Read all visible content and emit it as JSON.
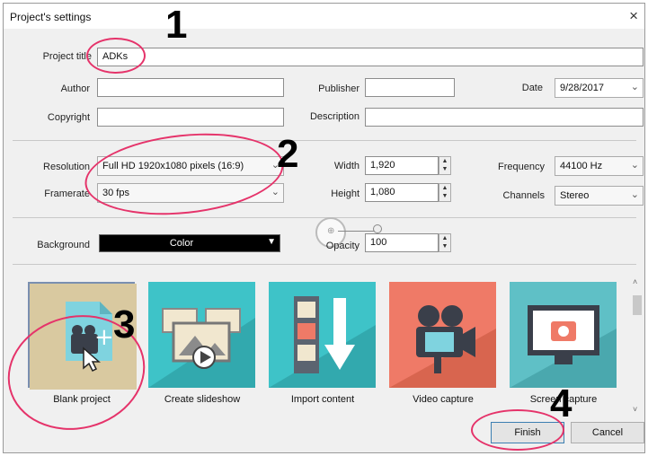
{
  "dialog": {
    "title": "Project's settings",
    "close_glyph": "×"
  },
  "fields": {
    "project_title_label": "Project title",
    "project_title_value": "ADKs",
    "author_label": "Author",
    "author_value": "",
    "publisher_label": "Publisher",
    "publisher_value": "",
    "date_label": "Date",
    "date_value": "9/28/2017",
    "copyright_label": "Copyright",
    "copyright_value": "",
    "description_label": "Description",
    "description_value": ""
  },
  "video": {
    "resolution_label": "Resolution",
    "resolution_value": "Full HD 1920x1080 pixels (16:9)",
    "framerate_label": "Framerate",
    "framerate_value": "30 fps",
    "width_label": "Width",
    "width_value": "1,920",
    "height_label": "Height",
    "height_value": "1,080",
    "frequency_label": "Frequency",
    "frequency_value": "44100 Hz",
    "channels_label": "Channels",
    "channels_value": "Stereo"
  },
  "background": {
    "label": "Background",
    "color_button": "Color",
    "opacity_label": "Opacity",
    "opacity_value": "100"
  },
  "templates": [
    {
      "label": "Blank project",
      "icon": "blank-project-icon",
      "bg": "#d9c9a0"
    },
    {
      "label": "Create slideshow",
      "icon": "slideshow-icon",
      "bg": "#3ec3c8"
    },
    {
      "label": "Import content",
      "icon": "import-content-icon",
      "bg": "#3ec3c8"
    },
    {
      "label": "Video capture",
      "icon": "video-camera-icon",
      "bg": "#ef7a67"
    },
    {
      "label": "Screen capture",
      "icon": "screen-capture-icon",
      "bg": "#5fc0c6"
    }
  ],
  "buttons": {
    "finish": "Finish",
    "cancel": "Cancel"
  },
  "annotations": {
    "n1": "1",
    "n2": "2",
    "n3": "3",
    "n4": "4",
    "color": "#e5336a"
  }
}
